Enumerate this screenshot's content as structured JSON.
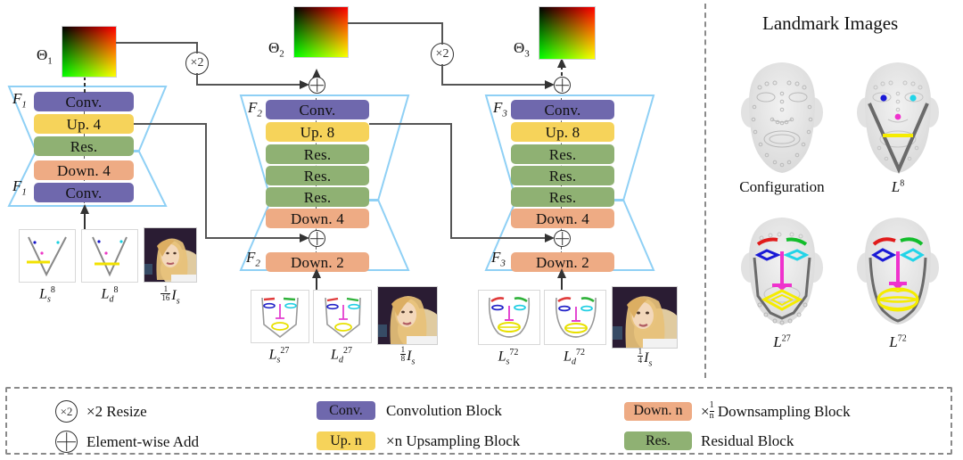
{
  "title": "Coarse-to-fine cascaded landmark-guided face generation network diagram",
  "stages": [
    {
      "id": "stage1",
      "theta_label": "Θ",
      "theta_sub": "1",
      "encoder_label": "F",
      "encoder_sub": "1",
      "decoder_label": "F",
      "decoder_sub": "1",
      "blocks_decoder": [
        {
          "text": "Conv.",
          "type": "conv"
        },
        {
          "text": "Up. 4",
          "type": "up"
        },
        {
          "text": "Res.",
          "type": "res"
        }
      ],
      "blocks_encoder": [
        {
          "text": "Down. 4",
          "type": "down"
        },
        {
          "text": "Conv.",
          "type": "conv"
        }
      ],
      "inputs": [
        {
          "kind": "sketch",
          "label": "L",
          "sup": "8",
          "sub": "s"
        },
        {
          "kind": "sketch",
          "label": "L",
          "sup": "8",
          "sub": "d"
        },
        {
          "kind": "photo",
          "label": "I",
          "sub": "s",
          "frac_num": "1",
          "frac_den": "16"
        }
      ]
    },
    {
      "id": "stage2",
      "theta_label": "Θ",
      "theta_sub": "2",
      "encoder_label": "F",
      "encoder_sub": "2",
      "decoder_label": "F",
      "decoder_sub": "2",
      "blocks_decoder": [
        {
          "text": "Conv.",
          "type": "conv"
        },
        {
          "text": "Up. 8",
          "type": "up"
        },
        {
          "text": "Res.",
          "type": "res"
        },
        {
          "text": "Res.",
          "type": "res"
        },
        {
          "text": "Res.",
          "type": "res"
        }
      ],
      "blocks_encoder": [
        {
          "text": "Down. 4",
          "type": "down"
        },
        {
          "text": "Down. 2",
          "type": "down"
        }
      ],
      "inputs": [
        {
          "kind": "sketch",
          "label": "L",
          "sup": "27",
          "sub": "s"
        },
        {
          "kind": "sketch",
          "label": "L",
          "sup": "27",
          "sub": "d"
        },
        {
          "kind": "photo",
          "label": "I",
          "sub": "s",
          "frac_num": "1",
          "frac_den": "8"
        }
      ]
    },
    {
      "id": "stage3",
      "theta_label": "Θ",
      "theta_sub": "3",
      "encoder_label": "F",
      "encoder_sub": "3",
      "decoder_label": "F",
      "decoder_sub": "3",
      "blocks_decoder": [
        {
          "text": "Conv.",
          "type": "conv"
        },
        {
          "text": "Up. 8",
          "type": "up"
        },
        {
          "text": "Res.",
          "type": "res"
        },
        {
          "text": "Res.",
          "type": "res"
        },
        {
          "text": "Res.",
          "type": "res"
        }
      ],
      "blocks_encoder": [
        {
          "text": "Down. 4",
          "type": "down"
        },
        {
          "text": "Down. 2",
          "type": "down"
        }
      ],
      "inputs": [
        {
          "kind": "sketch",
          "label": "L",
          "sup": "72",
          "sub": "s"
        },
        {
          "kind": "sketch",
          "label": "L",
          "sup": "72",
          "sub": "d"
        },
        {
          "kind": "photo",
          "label": "I",
          "sub": "s",
          "frac_num": "1",
          "frac_den": "4"
        }
      ]
    }
  ],
  "operators": {
    "resize_label": "×2",
    "add_label": "⊕"
  },
  "right_panel": {
    "title": "Landmark Images",
    "faces": [
      {
        "caption": "Configuration",
        "italic": false,
        "sup": ""
      },
      {
        "caption": "L",
        "italic": true,
        "sup": "8"
      },
      {
        "caption": "L",
        "italic": true,
        "sup": "27"
      },
      {
        "caption": "L",
        "italic": true,
        "sup": "72"
      }
    ]
  },
  "legend": {
    "items": [
      {
        "icon": "circle-x2",
        "chip": "×2",
        "text": "×2 Resize"
      },
      {
        "icon": "circle-plus",
        "chip": "⊕",
        "text": "Element-wise Add"
      },
      {
        "icon": "chip",
        "chip": "Conv.",
        "chip_type": "conv",
        "text": "Convolution Block"
      },
      {
        "icon": "chip",
        "chip": "Up. n",
        "chip_type": "up",
        "text": "×n Upsampling Block"
      },
      {
        "icon": "chip",
        "chip": "Down. n",
        "chip_type": "down",
        "text": "Downsampling Block",
        "prefix": "×",
        "frac_num": "1",
        "frac_den": "n"
      },
      {
        "icon": "chip",
        "chip": "Res.",
        "chip_type": "res",
        "text": "Residual Block"
      }
    ]
  },
  "colors": {
    "conv": "#6f68ad",
    "up": "#f6d35a",
    "res": "#8fb173",
    "down": "#eeab84",
    "trapezoid_outline": "#8fd0f5",
    "wire": "#555555",
    "divider": "#8a8a8a"
  }
}
